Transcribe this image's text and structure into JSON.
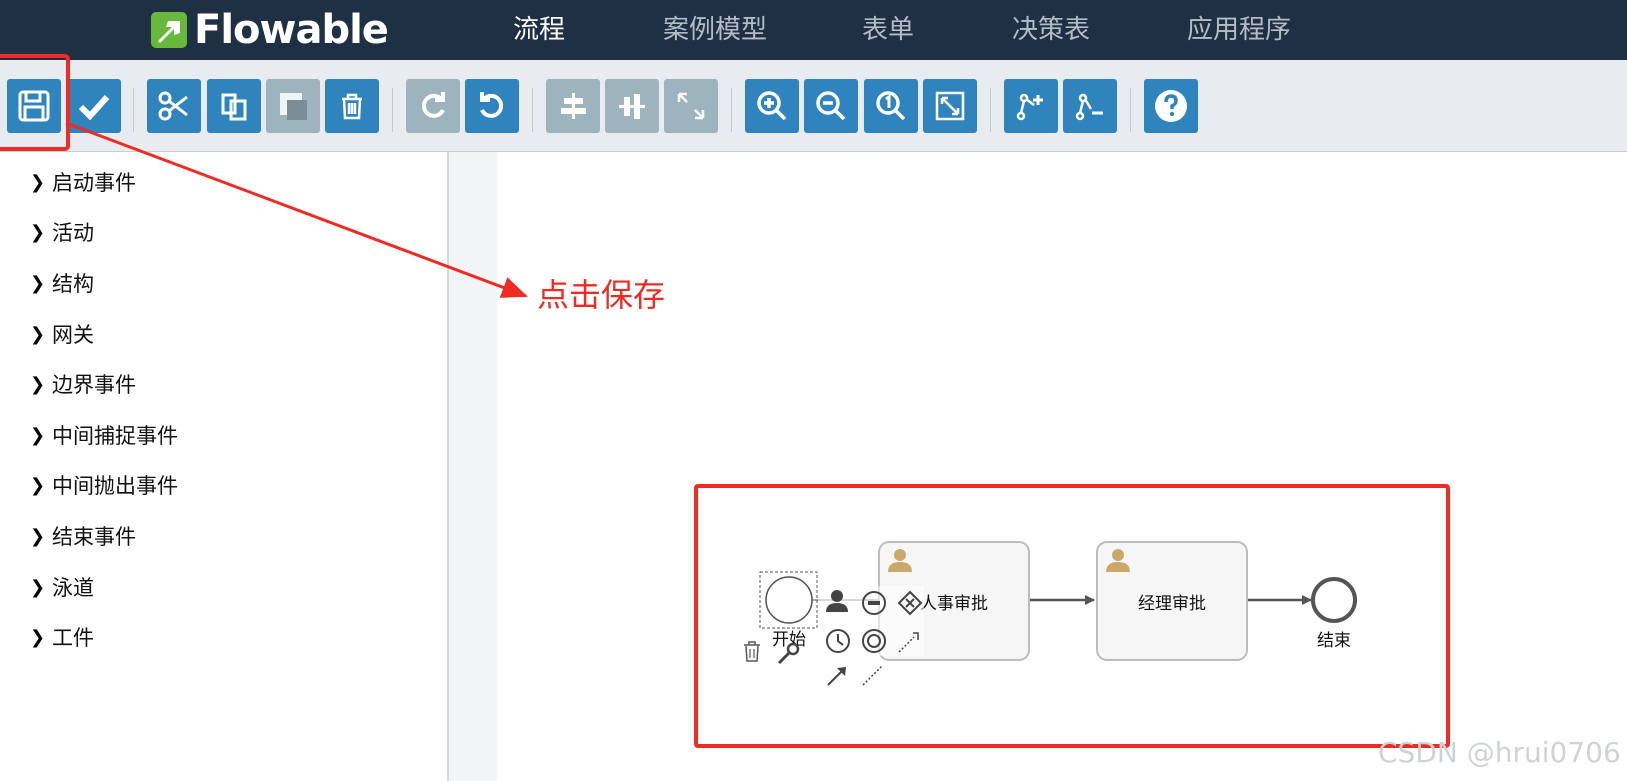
{
  "app": {
    "logo_text": "Flowable"
  },
  "nav": {
    "items": [
      {
        "label": "流程",
        "active": true
      },
      {
        "label": "案例模型",
        "active": false
      },
      {
        "label": "表单",
        "active": false
      },
      {
        "label": "决策表",
        "active": false
      },
      {
        "label": "应用程序",
        "active": false
      }
    ]
  },
  "toolbar": {
    "buttons": [
      {
        "icon": "save-icon",
        "enabled": true
      },
      {
        "icon": "validate-icon",
        "enabled": true
      },
      {
        "icon": "cut-icon",
        "enabled": true
      },
      {
        "icon": "copy-icon",
        "enabled": true
      },
      {
        "icon": "paste-icon",
        "enabled": false
      },
      {
        "icon": "delete-icon",
        "enabled": true
      },
      {
        "icon": "redo-icon",
        "enabled": false
      },
      {
        "icon": "undo-icon",
        "enabled": true
      },
      {
        "icon": "align-horizontal-icon",
        "enabled": false
      },
      {
        "icon": "align-vertical-icon",
        "enabled": false
      },
      {
        "icon": "same-size-icon",
        "enabled": false
      },
      {
        "icon": "zoom-in-icon",
        "enabled": true
      },
      {
        "icon": "zoom-out-icon",
        "enabled": true
      },
      {
        "icon": "zoom-actual-icon",
        "enabled": true
      },
      {
        "icon": "zoom-fit-icon",
        "enabled": true
      },
      {
        "icon": "add-bendpoint-icon",
        "enabled": true
      },
      {
        "icon": "remove-bendpoint-icon",
        "enabled": true
      },
      {
        "icon": "help-icon",
        "enabled": true
      }
    ]
  },
  "palette": {
    "items": [
      {
        "label": "启动事件"
      },
      {
        "label": "活动"
      },
      {
        "label": "结构"
      },
      {
        "label": "网关"
      },
      {
        "label": "边界事件"
      },
      {
        "label": "中间捕捉事件"
      },
      {
        "label": "中间抛出事件"
      },
      {
        "label": "结束事件"
      },
      {
        "label": "泳道"
      },
      {
        "label": "工件"
      }
    ]
  },
  "diagram": {
    "start_event_label": "开始",
    "task1_label": "人事审批",
    "task2_label": "经理审批",
    "end_event_label": "结束"
  },
  "annotation": {
    "text": "点击保存"
  },
  "watermark": {
    "text": "CSDN @hrui0706"
  },
  "colors": {
    "nav_bg": "#1f2f44",
    "button_blue": "#2f84bd",
    "button_disabled": "#9db3bd",
    "annotation_red": "#ee2b24",
    "user_icon": "#c9a86a"
  }
}
